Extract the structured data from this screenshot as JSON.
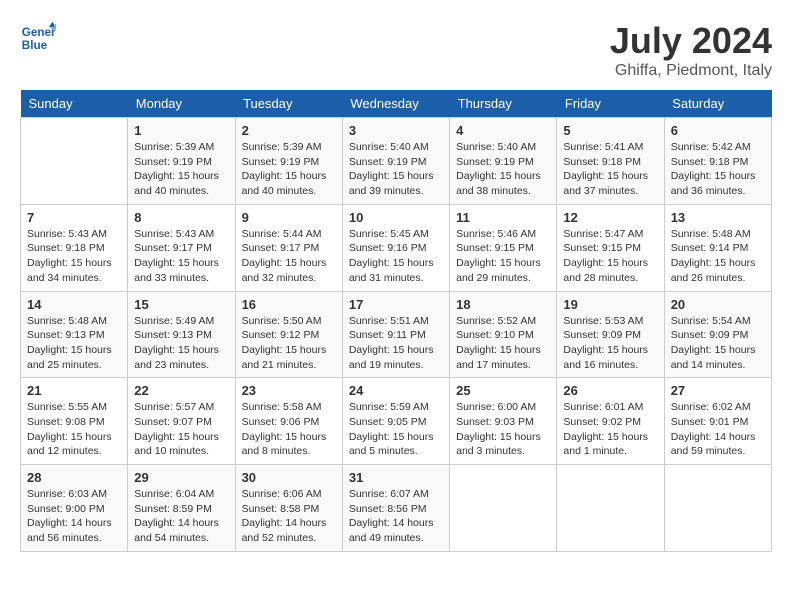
{
  "logo": {
    "line1": "General",
    "line2": "Blue"
  },
  "title": "July 2024",
  "location": "Ghiffa, Piedmont, Italy",
  "weekdays": [
    "Sunday",
    "Monday",
    "Tuesday",
    "Wednesday",
    "Thursday",
    "Friday",
    "Saturday"
  ],
  "weeks": [
    [
      {
        "day": "",
        "sunrise": "",
        "sunset": "",
        "daylight": ""
      },
      {
        "day": "1",
        "sunrise": "Sunrise: 5:39 AM",
        "sunset": "Sunset: 9:19 PM",
        "daylight": "Daylight: 15 hours and 40 minutes."
      },
      {
        "day": "2",
        "sunrise": "Sunrise: 5:39 AM",
        "sunset": "Sunset: 9:19 PM",
        "daylight": "Daylight: 15 hours and 40 minutes."
      },
      {
        "day": "3",
        "sunrise": "Sunrise: 5:40 AM",
        "sunset": "Sunset: 9:19 PM",
        "daylight": "Daylight: 15 hours and 39 minutes."
      },
      {
        "day": "4",
        "sunrise": "Sunrise: 5:40 AM",
        "sunset": "Sunset: 9:19 PM",
        "daylight": "Daylight: 15 hours and 38 minutes."
      },
      {
        "day": "5",
        "sunrise": "Sunrise: 5:41 AM",
        "sunset": "Sunset: 9:18 PM",
        "daylight": "Daylight: 15 hours and 37 minutes."
      },
      {
        "day": "6",
        "sunrise": "Sunrise: 5:42 AM",
        "sunset": "Sunset: 9:18 PM",
        "daylight": "Daylight: 15 hours and 36 minutes."
      }
    ],
    [
      {
        "day": "7",
        "sunrise": "Sunrise: 5:43 AM",
        "sunset": "Sunset: 9:18 PM",
        "daylight": "Daylight: 15 hours and 34 minutes."
      },
      {
        "day": "8",
        "sunrise": "Sunrise: 5:43 AM",
        "sunset": "Sunset: 9:17 PM",
        "daylight": "Daylight: 15 hours and 33 minutes."
      },
      {
        "day": "9",
        "sunrise": "Sunrise: 5:44 AM",
        "sunset": "Sunset: 9:17 PM",
        "daylight": "Daylight: 15 hours and 32 minutes."
      },
      {
        "day": "10",
        "sunrise": "Sunrise: 5:45 AM",
        "sunset": "Sunset: 9:16 PM",
        "daylight": "Daylight: 15 hours and 31 minutes."
      },
      {
        "day": "11",
        "sunrise": "Sunrise: 5:46 AM",
        "sunset": "Sunset: 9:15 PM",
        "daylight": "Daylight: 15 hours and 29 minutes."
      },
      {
        "day": "12",
        "sunrise": "Sunrise: 5:47 AM",
        "sunset": "Sunset: 9:15 PM",
        "daylight": "Daylight: 15 hours and 28 minutes."
      },
      {
        "day": "13",
        "sunrise": "Sunrise: 5:48 AM",
        "sunset": "Sunset: 9:14 PM",
        "daylight": "Daylight: 15 hours and 26 minutes."
      }
    ],
    [
      {
        "day": "14",
        "sunrise": "Sunrise: 5:48 AM",
        "sunset": "Sunset: 9:13 PM",
        "daylight": "Daylight: 15 hours and 25 minutes."
      },
      {
        "day": "15",
        "sunrise": "Sunrise: 5:49 AM",
        "sunset": "Sunset: 9:13 PM",
        "daylight": "Daylight: 15 hours and 23 minutes."
      },
      {
        "day": "16",
        "sunrise": "Sunrise: 5:50 AM",
        "sunset": "Sunset: 9:12 PM",
        "daylight": "Daylight: 15 hours and 21 minutes."
      },
      {
        "day": "17",
        "sunrise": "Sunrise: 5:51 AM",
        "sunset": "Sunset: 9:11 PM",
        "daylight": "Daylight: 15 hours and 19 minutes."
      },
      {
        "day": "18",
        "sunrise": "Sunrise: 5:52 AM",
        "sunset": "Sunset: 9:10 PM",
        "daylight": "Daylight: 15 hours and 17 minutes."
      },
      {
        "day": "19",
        "sunrise": "Sunrise: 5:53 AM",
        "sunset": "Sunset: 9:09 PM",
        "daylight": "Daylight: 15 hours and 16 minutes."
      },
      {
        "day": "20",
        "sunrise": "Sunrise: 5:54 AM",
        "sunset": "Sunset: 9:09 PM",
        "daylight": "Daylight: 15 hours and 14 minutes."
      }
    ],
    [
      {
        "day": "21",
        "sunrise": "Sunrise: 5:55 AM",
        "sunset": "Sunset: 9:08 PM",
        "daylight": "Daylight: 15 hours and 12 minutes."
      },
      {
        "day": "22",
        "sunrise": "Sunrise: 5:57 AM",
        "sunset": "Sunset: 9:07 PM",
        "daylight": "Daylight: 15 hours and 10 minutes."
      },
      {
        "day": "23",
        "sunrise": "Sunrise: 5:58 AM",
        "sunset": "Sunset: 9:06 PM",
        "daylight": "Daylight: 15 hours and 8 minutes."
      },
      {
        "day": "24",
        "sunrise": "Sunrise: 5:59 AM",
        "sunset": "Sunset: 9:05 PM",
        "daylight": "Daylight: 15 hours and 5 minutes."
      },
      {
        "day": "25",
        "sunrise": "Sunrise: 6:00 AM",
        "sunset": "Sunset: 9:03 PM",
        "daylight": "Daylight: 15 hours and 3 minutes."
      },
      {
        "day": "26",
        "sunrise": "Sunrise: 6:01 AM",
        "sunset": "Sunset: 9:02 PM",
        "daylight": "Daylight: 15 hours and 1 minute."
      },
      {
        "day": "27",
        "sunrise": "Sunrise: 6:02 AM",
        "sunset": "Sunset: 9:01 PM",
        "daylight": "Daylight: 14 hours and 59 minutes."
      }
    ],
    [
      {
        "day": "28",
        "sunrise": "Sunrise: 6:03 AM",
        "sunset": "Sunset: 9:00 PM",
        "daylight": "Daylight: 14 hours and 56 minutes."
      },
      {
        "day": "29",
        "sunrise": "Sunrise: 6:04 AM",
        "sunset": "Sunset: 8:59 PM",
        "daylight": "Daylight: 14 hours and 54 minutes."
      },
      {
        "day": "30",
        "sunrise": "Sunrise: 6:06 AM",
        "sunset": "Sunset: 8:58 PM",
        "daylight": "Daylight: 14 hours and 52 minutes."
      },
      {
        "day": "31",
        "sunrise": "Sunrise: 6:07 AM",
        "sunset": "Sunset: 8:56 PM",
        "daylight": "Daylight: 14 hours and 49 minutes."
      },
      {
        "day": "",
        "sunrise": "",
        "sunset": "",
        "daylight": ""
      },
      {
        "day": "",
        "sunrise": "",
        "sunset": "",
        "daylight": ""
      },
      {
        "day": "",
        "sunrise": "",
        "sunset": "",
        "daylight": ""
      }
    ]
  ]
}
